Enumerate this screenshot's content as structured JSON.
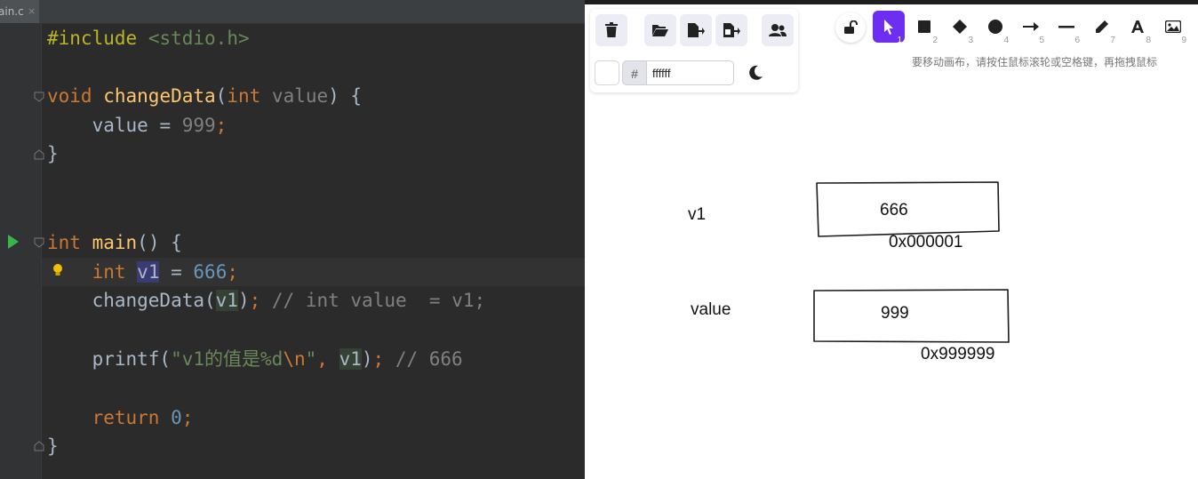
{
  "editor": {
    "tab": {
      "filename": "ain.c",
      "close": "×"
    },
    "lines": {
      "l1": {
        "directive": "#include",
        "header": "<stdio.h>"
      },
      "l3": {
        "type": "void",
        "name": "changeData",
        "open": "(",
        "ptype": "int",
        "pname": "value",
        "close": ") {"
      },
      "l4": {
        "lhs": "value",
        "op": " = ",
        "val": "999",
        "semi": ";"
      },
      "l5": {
        "brace": "}"
      },
      "l8": {
        "type": "int",
        "name": "main",
        "rest": "() {"
      },
      "l9": {
        "type": "int",
        "var": "v1",
        "op": " = ",
        "val": "666",
        "semi": ";"
      },
      "l10": {
        "call": "changeData(",
        "arg": "v1",
        "close": ")",
        "semi": ";",
        "comment": " // int value  = v1;"
      },
      "l12": {
        "call": "printf(",
        "str1": "\"v1的值是%d",
        "esc": "\\n",
        "str2": "\"",
        "comma": ", ",
        "arg": "v1",
        "close": ")",
        "semi": ";",
        "comment": " // 666"
      },
      "l14": {
        "kw": "return",
        "val": "0",
        "semi": ";"
      },
      "l15": {
        "brace": "}"
      }
    }
  },
  "whiteboard": {
    "color_input": {
      "hash": "#",
      "value": "ffffff"
    },
    "tool_numbers": [
      "1",
      "2",
      "3",
      "4",
      "5",
      "6",
      "7",
      "8",
      "9"
    ],
    "hint": "要移动画布，请按住鼠标滚轮或空格键，再拖拽鼠标",
    "canvas": {
      "label_v1": "v1",
      "box1_value": "666",
      "addr1": "0x000001",
      "label_value": "value",
      "box2_value": "999",
      "addr2": "0x999999"
    },
    "accent_color": "#6e2ef2"
  }
}
